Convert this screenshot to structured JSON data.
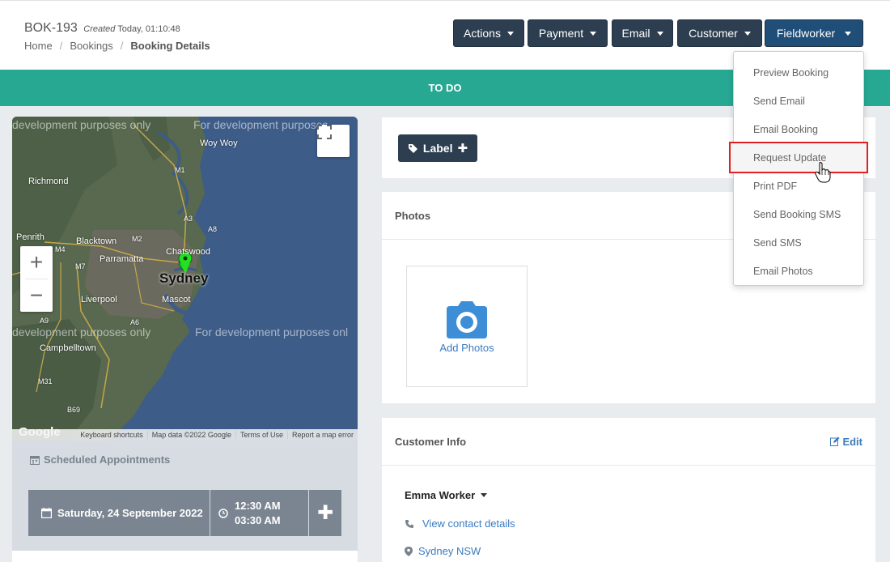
{
  "header": {
    "booking_id": "BOK-193",
    "created_label": "Created",
    "created_time": "Today, 01:10:48",
    "breadcrumb": {
      "home": "Home",
      "bookings": "Bookings",
      "current": "Booking Details"
    },
    "buttons": {
      "actions": "Actions",
      "payment": "Payment",
      "email": "Email",
      "customer": "Customer",
      "fieldworker": "Fieldworker"
    }
  },
  "status": {
    "label": "TO DO",
    "color": "#26a893"
  },
  "map": {
    "watermark": "For development purposes only",
    "watermark_left": "development purposes only",
    "watermark_right": "For development purposes onl",
    "watermark_top_right": "For development purposes",
    "places": {
      "sydney": "Sydney",
      "richmond": "Richmond",
      "penrith": "Penrith",
      "blacktown": "Blacktown",
      "parramatta": "Parramatta",
      "chatswood": "Chatswood",
      "liverpool": "Liverpool",
      "mascot": "Mascot",
      "campbelltown": "Campbelltown",
      "woy_woy": "Woy Woy"
    },
    "roads": {
      "m1": "M1",
      "m2": "M2",
      "m4": "M4",
      "m7": "M7",
      "a3": "A3",
      "a8": "A8",
      "a9": "A9",
      "a6": "A6",
      "m31": "M31",
      "b69": "B69"
    },
    "footer": {
      "shortcuts": "Keyboard shortcuts",
      "data": "Map data ©2022 Google",
      "terms": "Terms of Use",
      "report": "Report a map error"
    },
    "logo": "Google"
  },
  "schedule": {
    "title": "Scheduled Appointments",
    "date": "Saturday, 24 September 2022",
    "start": "12:30 AM",
    "end": "03:30 AM"
  },
  "labels": {
    "button": "Label"
  },
  "photos": {
    "title": "Photos",
    "add": "Add Photos"
  },
  "customer": {
    "title": "Customer Info",
    "edit": "Edit",
    "name": "Emma Worker",
    "contact": "View contact details",
    "location": "Sydney NSW"
  },
  "dropdown": {
    "items": [
      "Preview Booking",
      "Send Email",
      "Email Booking",
      "Request Update",
      "Print PDF",
      "Send Booking SMS",
      "Send SMS",
      "Email Photos"
    ],
    "highlighted": "Request Update"
  }
}
